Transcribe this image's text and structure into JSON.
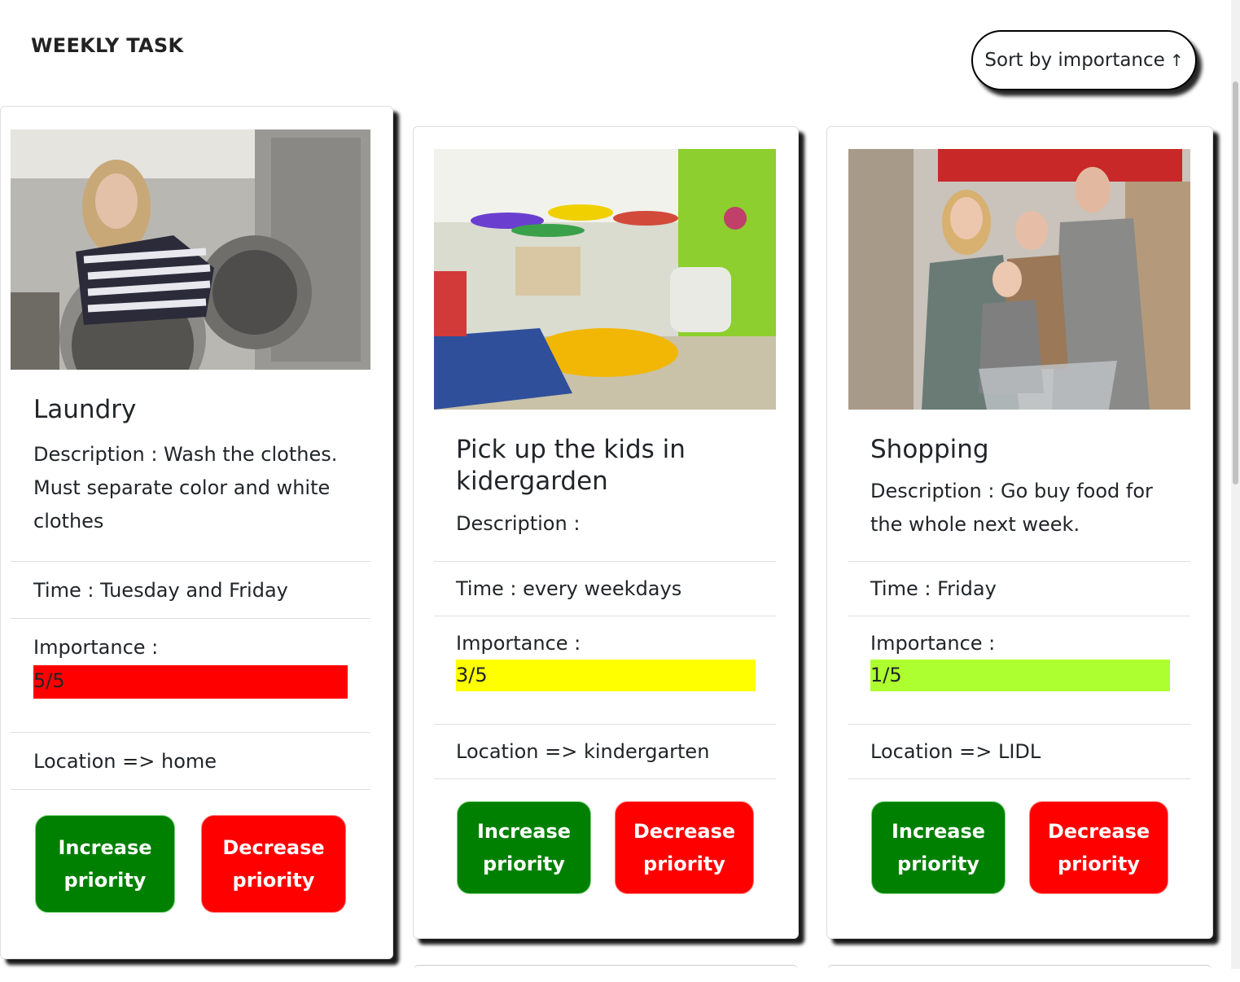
{
  "header": {
    "brand": "WEEKLY TASK",
    "sort_label": "Sort by importance",
    "sort_icon": "up-arrow-icon"
  },
  "colors": {
    "increase": "#008000",
    "decrease": "#ff0000",
    "high": "#ff0000",
    "medium": "#ffff00",
    "low": "#adff2f"
  },
  "tasks": [
    {
      "title": "Laundry",
      "description": "Description : Wash the clothes. Must separate color and white clothes",
      "time": "Time : Tuesday and Friday",
      "importance_label": "Importance :",
      "importance": "5/5",
      "importance_color": "#ff0000",
      "location": "Location => home",
      "increase": "Increase priority",
      "decrease": "Decrease priority",
      "image": "laundry-photo"
    },
    {
      "title": "Pick up the kids in kidergarden",
      "description": "Description :",
      "time": "Time : every weekdays",
      "importance_label": "Importance :",
      "importance": "3/5",
      "importance_color": "#ffff00",
      "location": "Location => kindergarten",
      "increase": "Increase priority",
      "decrease": "Decrease priority",
      "image": "kindergarten-photo"
    },
    {
      "title": "Shopping",
      "description": "Description : Go buy food for the whole next week.",
      "time": "Time : Friday",
      "importance_label": "Importance :",
      "importance": "1/5",
      "importance_color": "#adff2f",
      "location": "Location => LIDL",
      "increase": "Increase priority",
      "decrease": "Decrease priority",
      "image": "shopping-photo"
    }
  ]
}
